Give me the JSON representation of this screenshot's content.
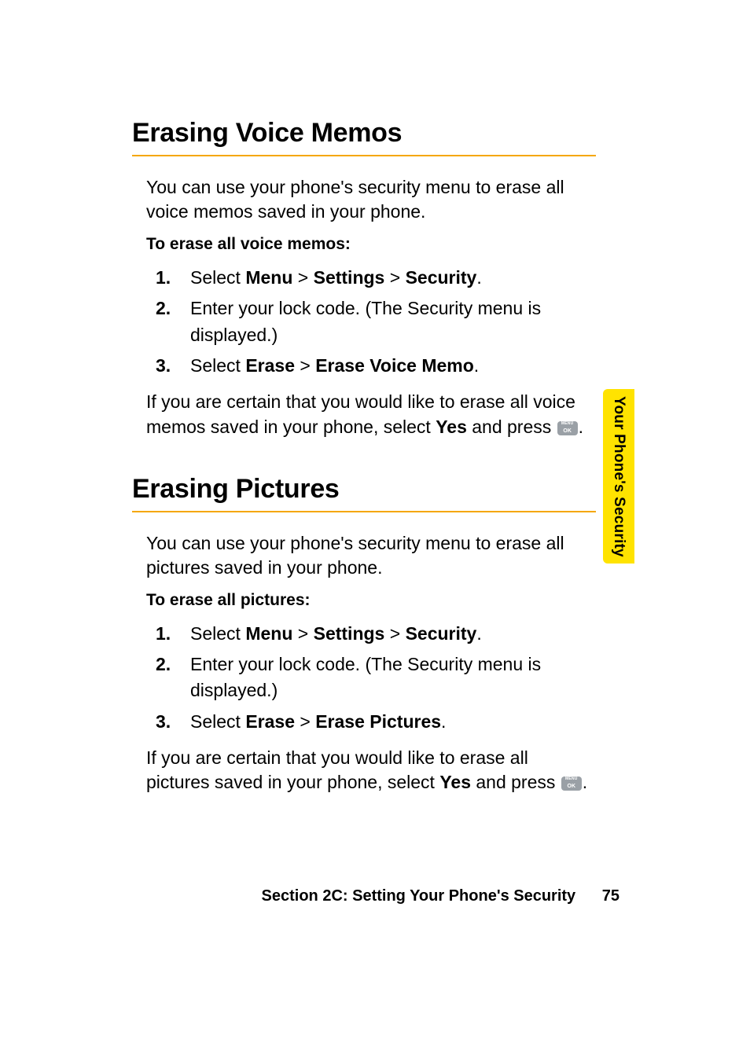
{
  "sidebar": {
    "label": "Your Phone's Security"
  },
  "footer": {
    "section": "Section 2C: Setting Your Phone's Security",
    "page": "75"
  },
  "sections": [
    {
      "title": "Erasing Voice Memos",
      "intro": "You can use your phone's security menu to erase all voice memos saved in your phone.",
      "sub": "To erase all voice memos:",
      "steps": [
        {
          "num": "1.",
          "prefix": "Select ",
          "path": [
            "Menu",
            "Settings",
            "Security"
          ],
          "suffix": "."
        },
        {
          "num": "2.",
          "plain": "Enter your lock code. (The Security menu is displayed.)"
        },
        {
          "num": "3.",
          "prefix": "Select ",
          "path": [
            "Erase",
            "Erase Voice Memo"
          ],
          "suffix": "."
        }
      ],
      "after": {
        "pre": "If you are certain that you would like to erase all voice memos saved in your phone, select ",
        "bold": "Yes",
        "mid": " and press ",
        "icon": "menu-ok",
        "post": "."
      }
    },
    {
      "title": "Erasing Pictures",
      "intro": "You can use your phone's security menu to erase all pictures saved in your phone.",
      "sub": "To erase all pictures:",
      "steps": [
        {
          "num": "1.",
          "prefix": "Select ",
          "path": [
            "Menu",
            "Settings",
            "Security"
          ],
          "suffix": "."
        },
        {
          "num": "2.",
          "plain": "Enter your lock code. (The Security menu is displayed.)"
        },
        {
          "num": "3.",
          "prefix": "Select ",
          "path": [
            "Erase",
            "Erase Pictures"
          ],
          "suffix": "."
        }
      ],
      "after": {
        "pre": "If you are certain that you would like to erase all pictures saved in your phone, select ",
        "bold": "Yes",
        "mid": " and press ",
        "icon": "menu-ok",
        "post": "."
      }
    }
  ]
}
